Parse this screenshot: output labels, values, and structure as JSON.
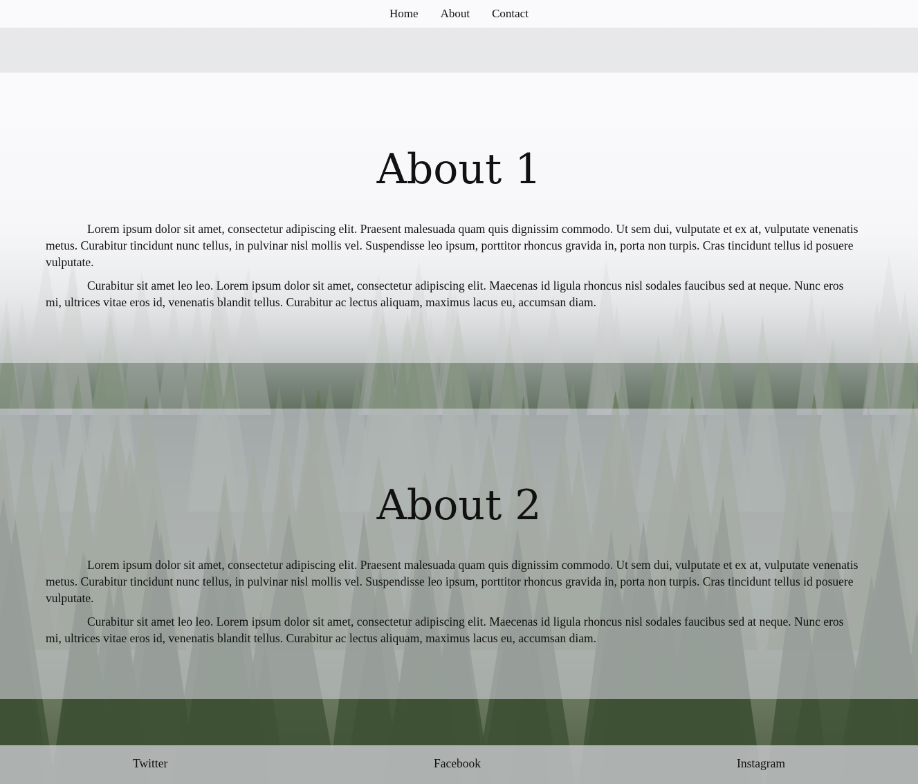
{
  "nav": {
    "items": [
      {
        "label": "Home"
      },
      {
        "label": "About"
      },
      {
        "label": "Contact"
      }
    ]
  },
  "sections": [
    {
      "title": "About 1",
      "paragraphs": [
        "Lorem ipsum dolor sit amet, consectetur adipiscing elit. Praesent malesuada quam quis dignissim commodo. Ut sem dui, vulputate et ex at, vulputate venenatis metus. Curabitur tincidunt nunc tellus, in pulvinar nisl mollis vel. Suspendisse leo ipsum, porttitor rhoncus gravida in, porta non turpis. Cras tincidunt tellus id posuere vulputate.",
        "Curabitur sit amet leo leo. Lorem ipsum dolor sit amet, consectetur adipiscing elit. Maecenas id ligula rhoncus nisl sodales faucibus sed at neque. Nunc eros mi, ultrices vitae eros id, venenatis blandit tellus. Curabitur ac lectus aliquam, maximus lacus eu, accumsan diam."
      ]
    },
    {
      "title": "About 2",
      "paragraphs": [
        "Lorem ipsum dolor sit amet, consectetur adipiscing elit. Praesent malesuada quam quis dignissim commodo. Ut sem dui, vulputate et ex at, vulputate venenatis metus. Curabitur tincidunt nunc tellus, in pulvinar nisl mollis vel. Suspendisse leo ipsum, porttitor rhoncus gravida in, porta non turpis. Cras tincidunt tellus id posuere vulputate.",
        "Curabitur sit amet leo leo. Lorem ipsum dolor sit amet, consectetur adipiscing elit. Maecenas id ligula rhoncus nisl sodales faucibus sed at neque. Nunc eros mi, ultrices vitae eros id, venenatis blandit tellus. Curabitur ac lectus aliquam, maximus lacus eu, accumsan diam."
      ]
    }
  ],
  "footer": {
    "links": [
      {
        "label": "Twitter"
      },
      {
        "label": "Facebook"
      },
      {
        "label": "Instagram"
      }
    ]
  }
}
